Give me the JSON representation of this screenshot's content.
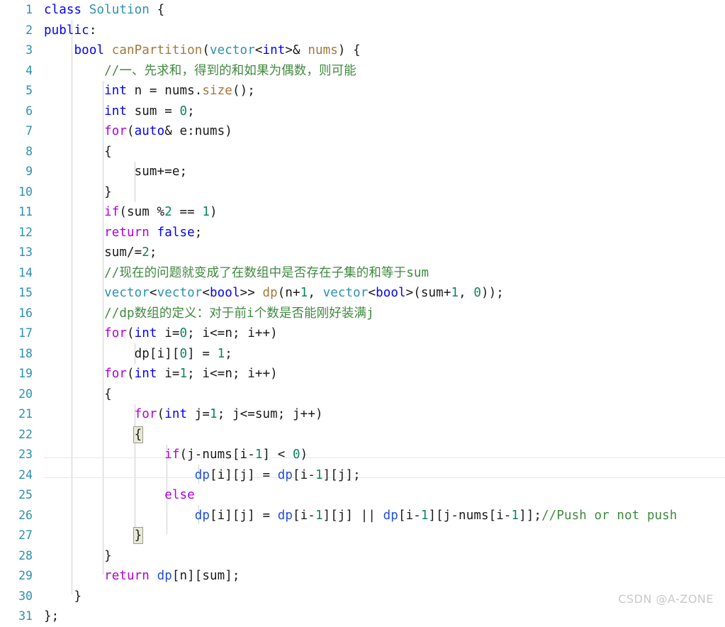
{
  "editor": {
    "language": "cpp",
    "total_lines": 31,
    "current_line": 24,
    "matching_brackets": [
      22,
      27
    ],
    "colors": {
      "background": "#ffffff",
      "line_number": "#2b8fb3",
      "keyword": "#0000ff",
      "control_keyword": "#af00db",
      "type": "#2b91af",
      "function": "#a3783c",
      "number": "#098658",
      "comment": "#3f8a3f",
      "variable": "#1f4fd8",
      "plain_text": "#1a1a1a",
      "indent_guide": "#cfcfcf",
      "current_line_rule": "#e8e8e8",
      "bracket_match_fill": "#e9e9d8",
      "bracket_match_border": "#9a9a8a",
      "watermark": "#c9c9c9"
    },
    "line_numbers": [
      1,
      2,
      3,
      4,
      5,
      6,
      7,
      8,
      9,
      10,
      11,
      12,
      13,
      14,
      15,
      16,
      17,
      18,
      19,
      20,
      21,
      22,
      23,
      24,
      25,
      26,
      27,
      28,
      29,
      30,
      31
    ],
    "lines": [
      "class Solution {",
      "public:",
      "    bool canPartition(vector<int>& nums) {",
      "        //一、先求和，得到的和如果为偶数，则可能",
      "        int n = nums.size();",
      "        int sum = 0;",
      "        for(auto& e:nums)",
      "        {",
      "            sum+=e;",
      "        }",
      "        if(sum %2 == 1)",
      "        return false;",
      "        sum/=2;",
      "        //现在的问题就变成了在数组中是否存在子集的和等于sum",
      "        vector<vector<bool>> dp(n+1, vector<bool>(sum+1, 0));",
      "        //dp数组的定义：对于前i个数是否能刚好装满j",
      "        for(int i=0; i<=n; i++)",
      "            dp[i][0] = 1;",
      "        for(int i=1; i<=n; i++)",
      "        {",
      "            for(int j=1; j<=sum; j++)",
      "            {",
      "                if(j-nums[i-1] < 0)",
      "                    dp[i][j] = dp[i-1][j];",
      "                else",
      "                    dp[i][j] = dp[i-1][j] || dp[i-1][j-nums[i-1]];//Push or not push",
      "            }",
      "        }",
      "        return dp[n][sum];",
      "    }",
      "};"
    ]
  },
  "watermark": {
    "text": "CSDN @A-ZONE"
  }
}
